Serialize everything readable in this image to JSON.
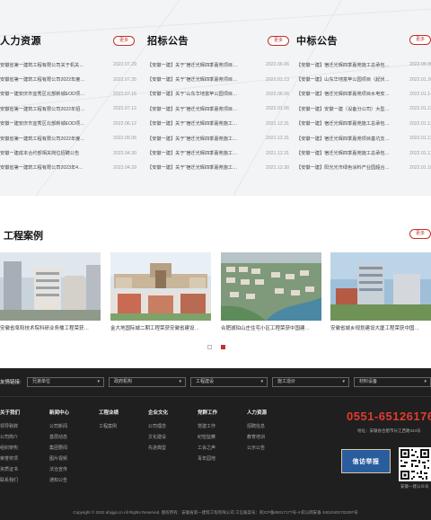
{
  "colors": {
    "accent": "#c0322b",
    "phone": "#e43a30",
    "footer_bg": "#1f1f1f",
    "band_bg": "#f3f4f6"
  },
  "news": [
    {
      "title": "人力资源",
      "more": "更多",
      "items": [
        {
          "title": "安徽省第一建筑工程有限公司关于机关…",
          "date": "2022.07.29"
        },
        {
          "title": "安徽省第一建筑工程有限公司2022年度…",
          "date": "2022.07.25"
        },
        {
          "title": "安徽一建安庆市宜秀区北部新城EOD项…",
          "date": "2022.07.15"
        },
        {
          "title": "安徽省第一建筑工程有限公司2022年招…",
          "date": "2022.07.12"
        },
        {
          "title": "安徽一建安庆市宜秀区北部新城EOD项…",
          "date": "2022.06.12"
        },
        {
          "title": "安徽省第一建筑工程有限公司2022年度…",
          "date": "2022.05.06"
        },
        {
          "title": "安徽一建成本合约部相关岗位招聘公告",
          "date": "2022.04.30"
        },
        {
          "title": "安徽省第一建筑工程有限公司2023年4…",
          "date": "2022.04.29"
        }
      ]
    },
    {
      "title": "招标公告",
      "more": "更多",
      "items": [
        {
          "title": "【安徽一建】关于“宿迁光辉四季嘉苑项目…",
          "date": "2022.06.06"
        },
        {
          "title": "【安徽一建】关于“宿迁光辉四季嘉苑项目…",
          "date": "2022.01.13"
        },
        {
          "title": "【安徽一建】关于“山东华地富苹公园项目…",
          "date": "2022.06.06"
        },
        {
          "title": "【安徽一建】关于“宿迁光辉四季嘉苑项目…",
          "date": "2022.01.06"
        },
        {
          "title": "【安徽一建】关于“宿迁光辉四季嘉苑施工…",
          "date": "2021.12.31"
        },
        {
          "title": "【安徽一建】关于“宿迁光辉四季嘉苑施工…",
          "date": "2021.12.31"
        },
        {
          "title": "【安徽一建】关于“宿迁光辉四季嘉苑施工…",
          "date": "2021.12.31"
        },
        {
          "title": "【安徽一建】关于“宿迁光辉四季嘉苑施工…",
          "date": "2021.12.30"
        }
      ]
    },
    {
      "title": "中标公告",
      "more": "更多",
      "items": [
        {
          "title": "【安徽一建】宿迁光辉四季嘉苑施工总承包…",
          "date": "2022.06.06"
        },
        {
          "title": "【安徽一建】山东华地富苹公园项目（起伏…",
          "date": "2022.01.26"
        },
        {
          "title": "【安徽一建】宿迁光辉四季嘉苑项目水电安…",
          "date": "2022.01.14"
        },
        {
          "title": "【安徽一建】安徽一建（设备分公司）大型…",
          "date": "2022.01.13"
        },
        {
          "title": "【安徽一建】宿迁光辉四季嘉苑施工总承包…",
          "date": "2022.01.12"
        },
        {
          "title": "【安徽一建】宿迁光辉四季嘉苑项目基坑支…",
          "date": "2022.01.11"
        },
        {
          "title": "【安徽一建】宿迁光辉四季嘉苑施工总承包…",
          "date": "2022.01.11"
        },
        {
          "title": "【安徽一建】阳光光市绿色涂料产业园超合…",
          "date": "2022.01.10"
        }
      ]
    }
  ],
  "cases": {
    "title": "工程案例",
    "more": "更多",
    "items": [
      {
        "caption": "安徽省阜阳技术院科研业务楼工程荣获…"
      },
      {
        "caption": "金大地国际城二期工程荣获安徽省建设…"
      },
      {
        "caption": "合肥琥珀山庄住宅小区工程荣获中国建…"
      },
      {
        "caption": "安徽省城乡规划建设大厦工程荣获中国…"
      }
    ]
  },
  "footer": {
    "friend_label": "友情链接:",
    "friend_links": [
      "兄弟单位",
      "政府机构",
      "工程建设",
      "施工造价",
      "材料设备"
    ],
    "columns": [
      {
        "title": "关于我们",
        "items": [
          "领导致辞",
          "公司简介",
          "组织架构",
          "荣誉奖项",
          "资质证书",
          "联系我们"
        ]
      },
      {
        "title": "新闻中心",
        "items": [
          "公司新闻",
          "基层动态",
          "集团要闻",
          "图片视频",
          "法治宣传",
          "通知公告"
        ]
      },
      {
        "title": "工程业绩",
        "items": [
          "工程案例"
        ]
      },
      {
        "title": "企业文化",
        "items": [
          "公司理念",
          "文化建设",
          "先进典型"
        ]
      },
      {
        "title": "党群工作",
        "items": [
          "党建工作",
          "纪检监察",
          "工会之声",
          "青年园地"
        ]
      },
      {
        "title": "人力资源",
        "items": [
          "招聘信息",
          "教育培训",
          "公示公告"
        ]
      }
    ],
    "phone": "0551-65126176",
    "address": "地址：安徽省合肥市长江西路334号",
    "promo": "信访举报",
    "qr_label": "安徽一建公众号",
    "copyright": "Copyright © 2022  ahyjgs.cn  All Rights Reserved.   版权所有：安徽省第一建筑工程有限公司   工信备案号：皖ICP备05017177号-4   皖公网安备 34010402702297号"
  }
}
